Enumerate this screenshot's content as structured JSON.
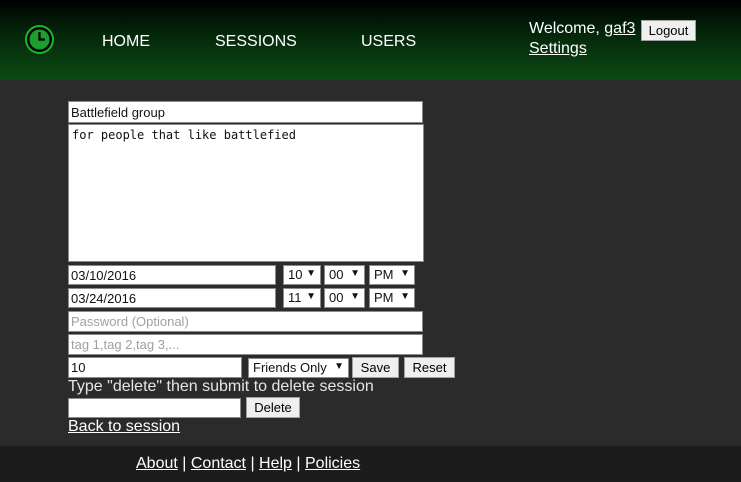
{
  "header": {
    "nav": [
      {
        "label": "HOME"
      },
      {
        "label": "SESSIONS"
      },
      {
        "label": "USERS"
      }
    ],
    "welcome_prefix": "Welcome, ",
    "username": "gaf3",
    "logout_label": "Logout",
    "settings_label": "Settings",
    "logo_icon": "clock-icon"
  },
  "form": {
    "name_value": "Battlefield group",
    "description_value": "for people that like battlefied",
    "start": {
      "date": "03/10/2016",
      "hour": "10",
      "minute": "00",
      "ampm": "PM"
    },
    "end": {
      "date": "03/24/2016",
      "hour": "11",
      "minute": "00",
      "ampm": "PM"
    },
    "password_placeholder": "Password (Optional)",
    "tags_placeholder": "tag 1,tag 2,tag 3,...",
    "size_value": "10",
    "visibility": "Friends Only",
    "save_label": "Save",
    "reset_label": "Reset",
    "delete_hint": "Type \"delete\" then submit to delete session",
    "delete_label": "Delete",
    "back_label": "Back to session"
  },
  "footer": {
    "links": [
      {
        "label": "About"
      },
      {
        "label": "Contact"
      },
      {
        "label": "Help"
      },
      {
        "label": "Policies"
      }
    ],
    "separator": " | "
  },
  "colors": {
    "header_green": "#0c4a14",
    "logo_green": "#22b22e",
    "page_bg": "#2b2b2b"
  }
}
